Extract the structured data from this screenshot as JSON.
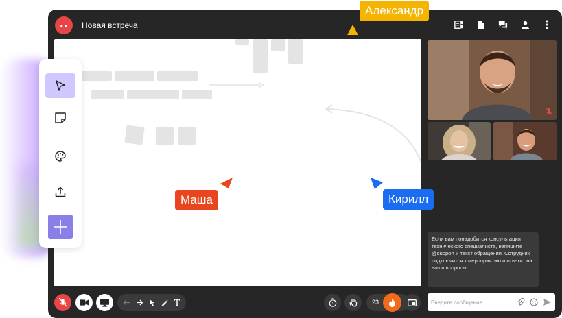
{
  "window": {
    "title": "Новая встреча"
  },
  "header_icons": [
    "board-icon",
    "document-icon",
    "chat-icon",
    "person-icon",
    "more-icon"
  ],
  "cursors": {
    "alexander": {
      "label": "Александр",
      "color": "#f5b400"
    },
    "masha": {
      "label": "Маша",
      "color": "#e8461e"
    },
    "kirill": {
      "label": "Кирилл",
      "color": "#1a6cf0"
    }
  },
  "toolbar": {
    "items": [
      "pointer-icon",
      "sticky-note-icon",
      "palette-icon",
      "upload-icon",
      "add-icon"
    ],
    "selected": "pointer-icon",
    "accent": "#8a7fe8"
  },
  "chat": {
    "message": "Если вам понадобится консультация технического специалиста, напишите @support и текст обращения. Сотрудник подключится к мероприятию и ответит на ваши вопросы.",
    "input_placeholder": "Введите сообщение"
  },
  "controls": {
    "participants_count": "23",
    "end_call_color": "#e84646",
    "fire_color": "#f26a1b"
  }
}
